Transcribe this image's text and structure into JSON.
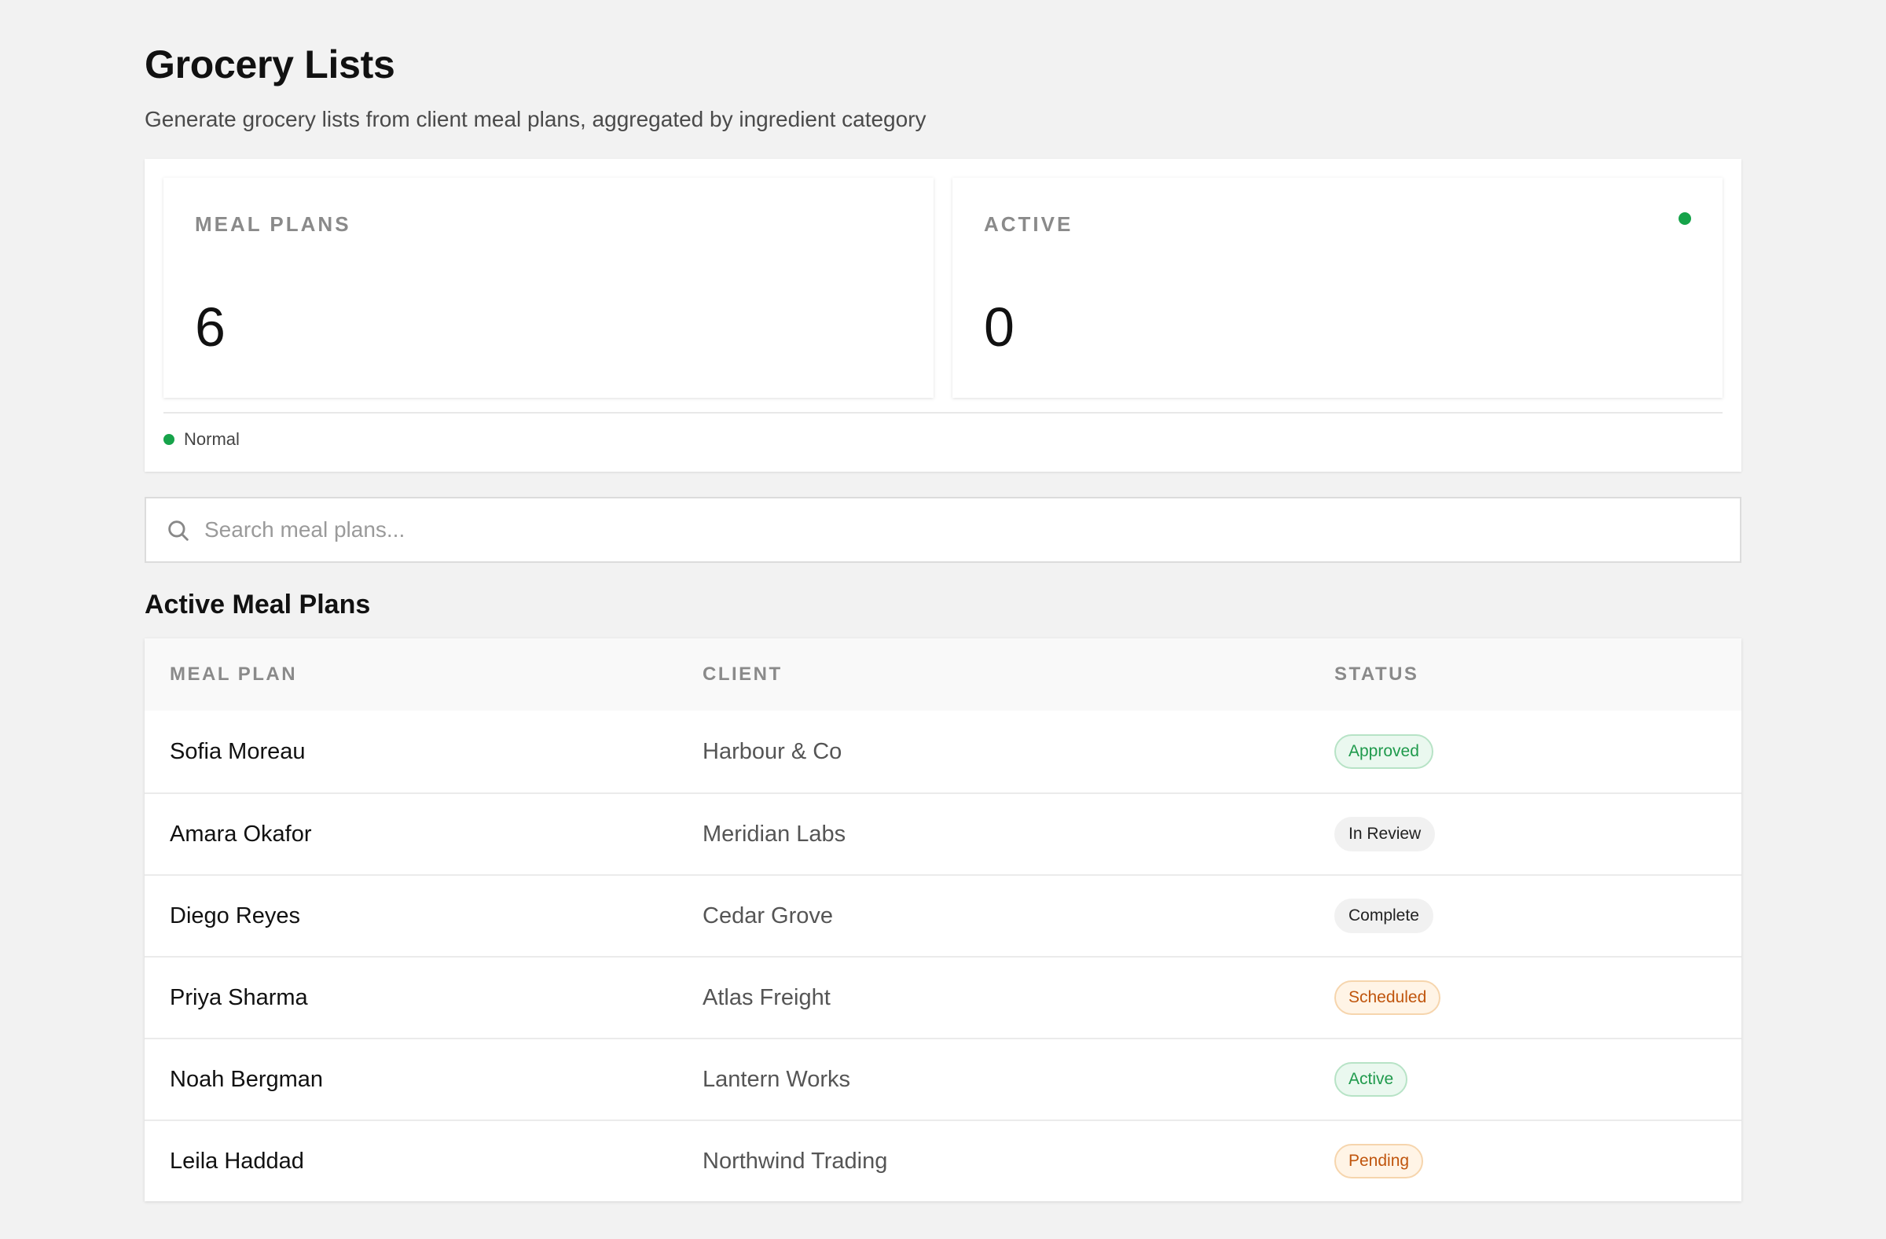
{
  "header": {
    "title": "Grocery Lists",
    "subtitle": "Generate grocery lists from client meal plans, aggregated by ingredient category"
  },
  "stats": [
    {
      "label": "MEAL PLANS",
      "value": "6"
    },
    {
      "label": "ACTIVE",
      "value": "0",
      "indicator_color": "#16a34a"
    }
  ],
  "legend": {
    "label": "Normal",
    "color": "#16a34a"
  },
  "search": {
    "placeholder": "Search meal plans...",
    "value": "",
    "icon": "search-icon"
  },
  "section": {
    "title": "Active Meal Plans"
  },
  "table": {
    "columns": [
      "MEAL PLAN",
      "CLIENT",
      "STATUS"
    ],
    "rows": [
      {
        "meal_plan": "Sofia Moreau",
        "client": "Harbour & Co",
        "status": "Approved",
        "status_tone": "green"
      },
      {
        "meal_plan": "Amara Okafor",
        "client": "Meridian Labs",
        "status": "In Review",
        "status_tone": "grey"
      },
      {
        "meal_plan": "Diego Reyes",
        "client": "Cedar Grove",
        "status": "Complete",
        "status_tone": "grey"
      },
      {
        "meal_plan": "Priya Sharma",
        "client": "Atlas Freight",
        "status": "Scheduled",
        "status_tone": "orange"
      },
      {
        "meal_plan": "Noah Bergman",
        "client": "Lantern Works",
        "status": "Active",
        "status_tone": "green"
      },
      {
        "meal_plan": "Leila Haddad",
        "client": "Northwind Trading",
        "status": "Pending",
        "status_tone": "orange"
      }
    ]
  },
  "colors": {
    "green": "#1f9a4c",
    "orange": "#c0550d",
    "background": "#f2f2f2"
  }
}
